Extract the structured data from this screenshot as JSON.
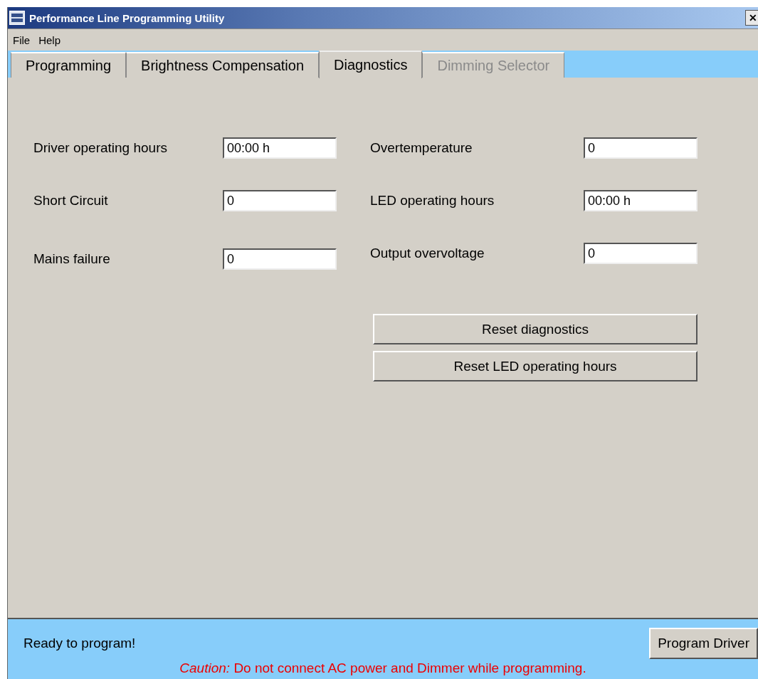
{
  "window": {
    "title": "Performance Line Programming Utility",
    "close": "✕"
  },
  "menu": [
    "File",
    "Help"
  ],
  "tabs": [
    {
      "label": "Programming",
      "selected": false,
      "disabled": false
    },
    {
      "label": "Brightness Compensation",
      "selected": false,
      "disabled": false
    },
    {
      "label": "Diagnostics",
      "selected": true,
      "disabled": false
    },
    {
      "label": "Dimming Selector",
      "selected": false,
      "disabled": true
    }
  ],
  "fields_left": [
    {
      "label": "Driver operating hours",
      "value": "00:00 h"
    },
    {
      "label": "Short Circuit",
      "value": "0"
    },
    {
      "label": "Mains failure",
      "value": "0"
    }
  ],
  "fields_right": [
    {
      "label": "Overtemperature",
      "value": "0"
    },
    {
      "label": "LED operating hours",
      "value": "00:00 h"
    },
    {
      "label": "Output overvoltage",
      "value": "0"
    }
  ],
  "buttons": [
    "Reset diagnostics",
    "Reset LED operating hours"
  ],
  "status_bar": {
    "status": "Ready to program!",
    "button": "Program Driver",
    "caution": "*Caution:* Do not connect AC power and Dimmer while programming."
  }
}
